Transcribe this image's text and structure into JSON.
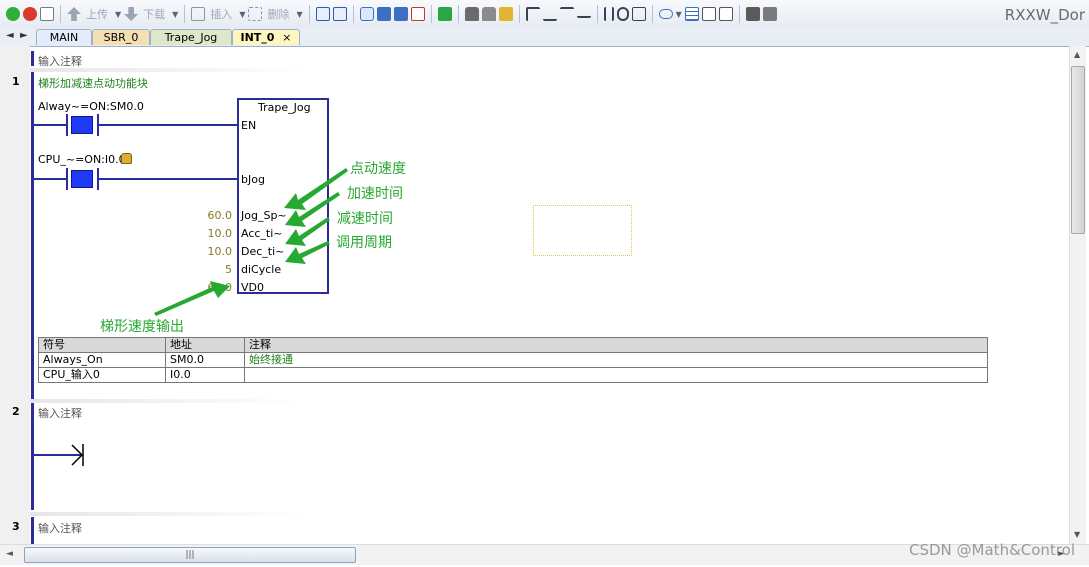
{
  "toolbar": {
    "upload_label": "上传",
    "download_label": "下载",
    "insert_label": "插入",
    "delete_label": "删除",
    "brand": "RXXW_Dor"
  },
  "tabs": [
    {
      "label": "MAIN",
      "active": false
    },
    {
      "label": "SBR_0",
      "active": false
    },
    {
      "label": "Trape_Jog",
      "active": false
    },
    {
      "label": "INT_0",
      "active": true
    }
  ],
  "editor": {
    "header_comment": "输入注释",
    "networks": [
      {
        "number": "1",
        "comment": "梯形加减速点动功能块",
        "contact1_label": "Alway~=ON:SM0.0",
        "contact2_label": "CPU_~=ON:I0.0",
        "block": {
          "name": "Trape_Jog",
          "pins": [
            "EN",
            "bJog",
            "Jog_Sp~",
            "Acc_ti~",
            "Dec_ti~",
            "diCycle",
            "VD0"
          ],
          "values": [
            "60.0",
            "10.0",
            "10.0",
            "5",
            "60.0"
          ]
        },
        "annotations": [
          "点动速度",
          "加速时间",
          "减速时间",
          "调用周期",
          "梯形速度输出"
        ],
        "symbol_table": {
          "headers": [
            "符号",
            "地址",
            "注释"
          ],
          "rows": [
            [
              "Always_On",
              "SM0.0",
              "始终接通"
            ],
            [
              "CPU_输入0",
              "I0.0",
              ""
            ]
          ]
        }
      },
      {
        "number": "2",
        "comment": "输入注释"
      },
      {
        "number": "3",
        "comment": "输入注释"
      }
    ]
  },
  "scrollbar": {
    "grip": "|||"
  },
  "watermark": "CSDN @Math&Control",
  "colors": {
    "rail": "#2b2b99",
    "contact": "#1f39f5",
    "annotation": "#27a830",
    "value": "#8a7a23",
    "active_tab": "#fff6bf"
  }
}
